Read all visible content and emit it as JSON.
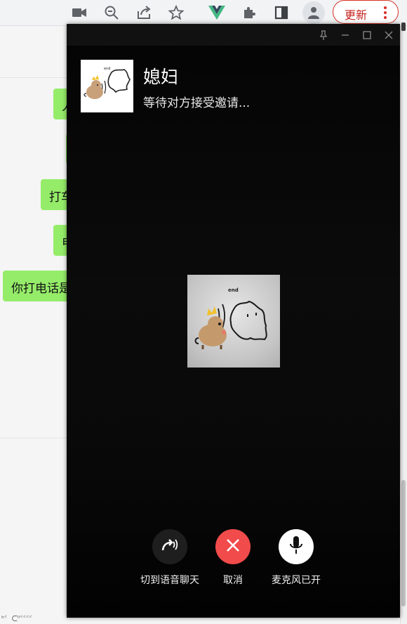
{
  "browser": {
    "toolbar_icons": [
      "camera-icon",
      "zoom-out-icon",
      "share-icon",
      "star-icon",
      "vue-devtools-icon",
      "extensions-icon",
      "side-panel-icon",
      "profile-icon"
    ],
    "update_label": "更新",
    "colors": {
      "update": "#d93025",
      "vue": "#41b883"
    }
  },
  "chat": {
    "bubble_color": "#95ec69",
    "bubbles": [
      {
        "text": "人"
      },
      {
        "text": ""
      },
      {
        "text": "打车"
      },
      {
        "text": "电"
      },
      {
        "text": "你打电话是"
      }
    ],
    "footer_fragment": "ᑋᑉ ᑕᑊᑊᑉᑉᑉᑉ"
  },
  "call": {
    "caller_name": "媳妇",
    "status": "等待对方接受邀请...",
    "sticker_text": "end",
    "titlebar_icons": [
      "pin-icon",
      "minimize-icon",
      "maximize-icon",
      "close-icon"
    ],
    "controls": [
      {
        "label": "切到语音聊天",
        "icon": "switch-to-voice-icon",
        "color": "#1e1e1e"
      },
      {
        "label": "取消",
        "icon": "cancel-icon",
        "color": "#f24b4b"
      },
      {
        "label": "麦克风已开",
        "icon": "microphone-icon",
        "color": "#ffffff"
      }
    ]
  }
}
